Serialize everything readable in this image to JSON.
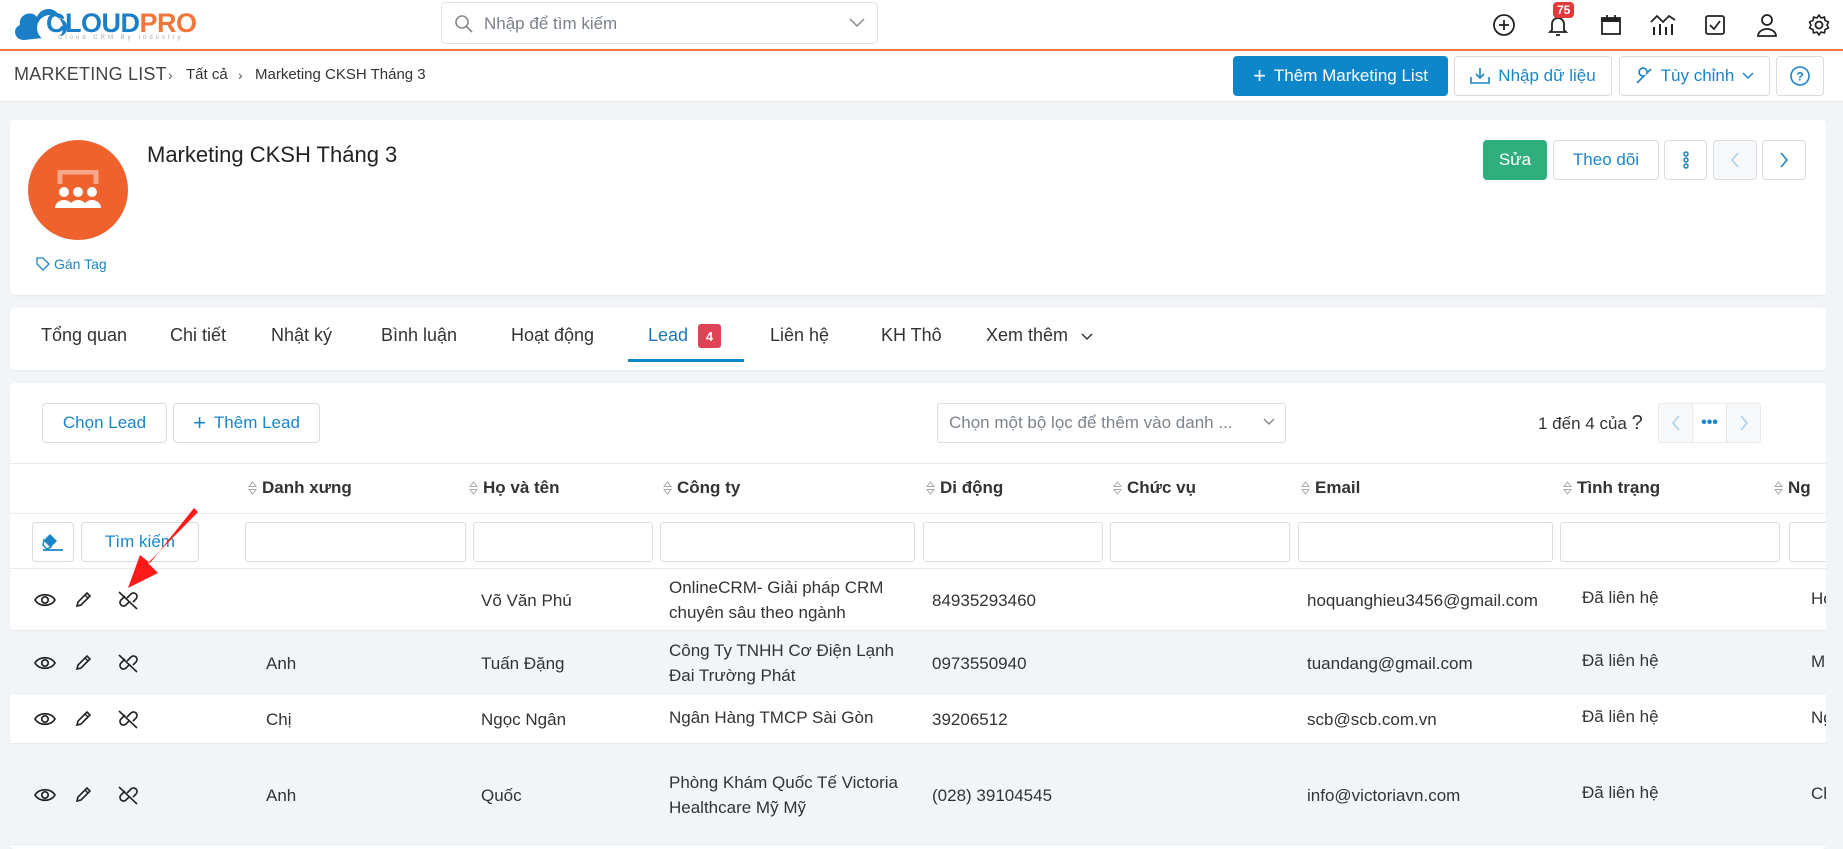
{
  "header": {
    "logo": {
      "brand_blue": "CLOUD",
      "brand_orange": "PRO",
      "tagline": "Cloud CRM By Industry"
    },
    "search": {
      "placeholder": "Nhập để tìm kiếm"
    },
    "icons": [
      "add-circle-icon",
      "bell-icon",
      "calendar-icon",
      "chart-icon",
      "checkbox-icon",
      "user-icon",
      "gear-icon"
    ],
    "notification_count": "75"
  },
  "breadcrumb": {
    "module": "MARKETING LIST",
    "level1": "Tất cả",
    "current": "Marketing CKSH Tháng 3"
  },
  "toolbar": {
    "add_label": "Thêm Marketing List",
    "import_label": "Nhập dữ liệu",
    "customize_label": "Tùy chỉnh",
    "help_icon": "question-circle-icon"
  },
  "record": {
    "title": "Marketing CKSH Tháng 3",
    "tag_label": "Gán Tag",
    "edit_label": "Sửa",
    "follow_label": "Theo dõi",
    "avatar_color": "#f0622d"
  },
  "tabs": [
    {
      "label": "Tổng quan"
    },
    {
      "label": "Chi tiết"
    },
    {
      "label": "Nhật ký"
    },
    {
      "label": "Bình luận"
    },
    {
      "label": "Hoạt động"
    },
    {
      "label": "Lead",
      "badge": "4",
      "active": true
    },
    {
      "label": "Liên hệ"
    },
    {
      "label": "KH Thô"
    },
    {
      "label": "Xem thêm"
    }
  ],
  "lead_list": {
    "select_label": "Chọn Lead",
    "add_label": "Thêm Lead",
    "filter_placeholder": "Chọn một bộ lọc để thêm vào danh ...",
    "pagination_text": "1 đến 4 của",
    "pagination_help": "?",
    "search_label": "Tìm kiếm",
    "columns": [
      "Danh xưng",
      "Họ và tên",
      "Công ty",
      "Di động",
      "Chức vụ",
      "Email",
      "Tình trạng",
      "Ng"
    ],
    "rows": [
      {
        "salutation": "",
        "name": "Võ Văn Phú",
        "company_l1": "OnlineCRM- Giải pháp CRM",
        "company_l2": "chuyên sâu theo ngành",
        "mobile": "84935293460",
        "title": "",
        "email": "hoquanghieu3456@gmail.com",
        "status": "Đã liên hệ",
        "next": "Ho"
      },
      {
        "salutation": "Anh",
        "name": "Tuấn Đặng",
        "company_l1": "Công Ty TNHH Cơ Điện Lạnh",
        "company_l2": "Đai Trường Phát",
        "mobile": "0973550940",
        "title": "",
        "email": "tuandang@gmail.com",
        "status": "Đã liên hệ",
        "next": "Ma"
      },
      {
        "salutation": "Chị",
        "name": "Ngọc Ngân",
        "company_l1": "Ngân Hàng TMCP Sài Gòn",
        "company_l2": "",
        "mobile": "39206512",
        "title": "",
        "email": "scb@scb.com.vn",
        "status": "Đã liên hệ",
        "next": "Ng"
      },
      {
        "salutation": "Anh",
        "name": "Quốc",
        "company_l1": "Phòng Khám Quốc Tế Victoria",
        "company_l2": "Healthcare Mỹ Mỹ",
        "mobile": "(028) 39104545",
        "title": "",
        "email": "info@victoriavn.com",
        "status": "Đã liên hệ",
        "next": "Ch"
      }
    ]
  },
  "colors": {
    "primary": "#0d87c9",
    "success": "#2faf7d",
    "accent_orange": "#f0763a",
    "badge_red": "#e03b3b",
    "annotation_arrow": "#ff1a1a"
  }
}
